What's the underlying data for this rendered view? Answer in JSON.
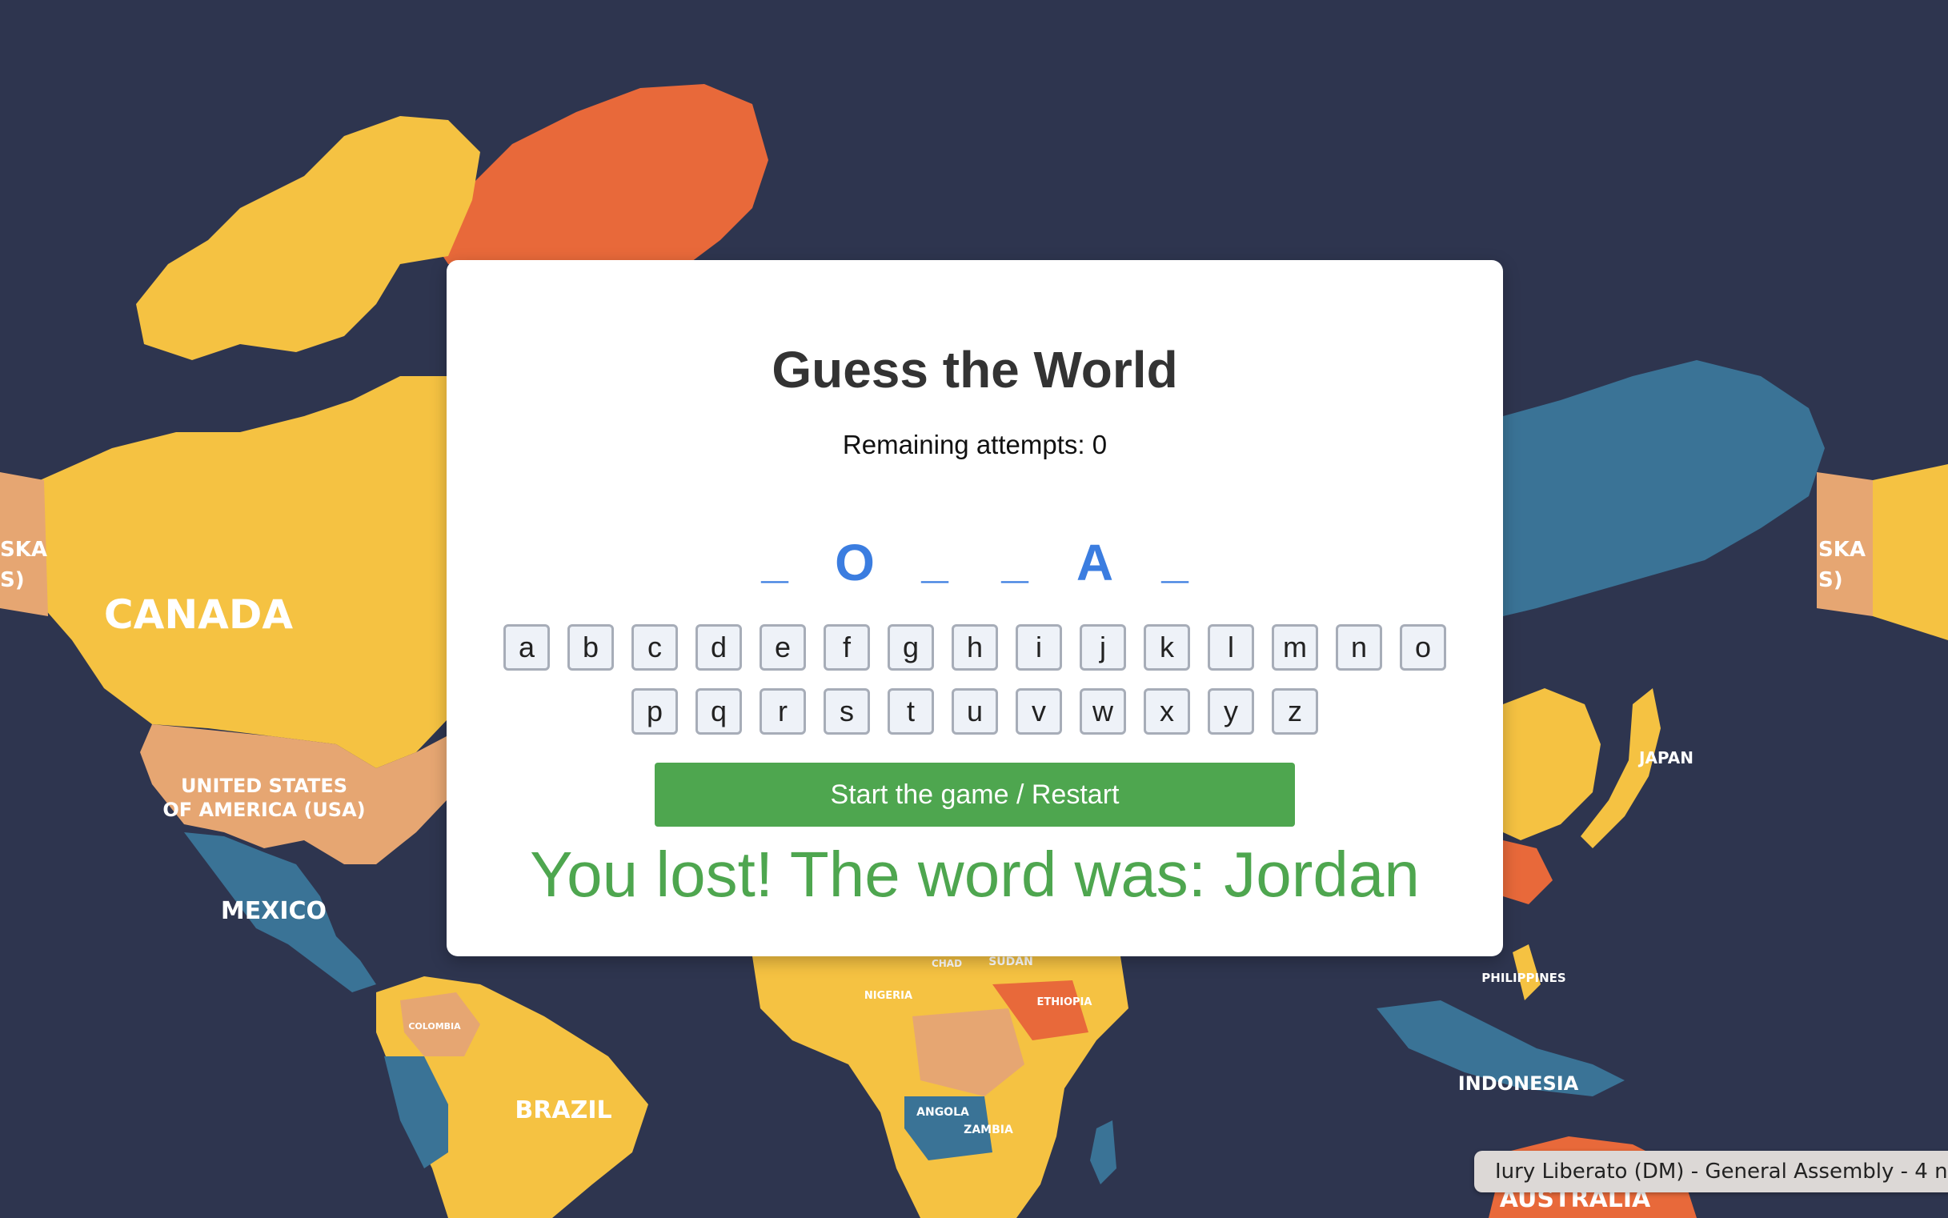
{
  "app": {
    "title": "Guess the World",
    "attempts_label": "Remaining attempts:",
    "attempts_value": "0"
  },
  "word": {
    "slots": [
      "_",
      "O",
      "_",
      "_",
      "A",
      "_"
    ]
  },
  "keyboard": {
    "row1": [
      "a",
      "b",
      "c",
      "d",
      "e",
      "f",
      "g",
      "h",
      "i",
      "j",
      "k",
      "l",
      "m",
      "n",
      "o"
    ],
    "row2": [
      "p",
      "q",
      "r",
      "s",
      "t",
      "u",
      "v",
      "w",
      "x",
      "y",
      "z"
    ]
  },
  "controls": {
    "start_label": "Start the game / Restart"
  },
  "result": {
    "message": "You lost! The word was: Jordan"
  },
  "map": {
    "labels": {
      "canada": "CANADA",
      "usa_line1": "UNITED STATES",
      "usa_line2": "OF AMERICA (USA)",
      "mexico": "MEXICO",
      "brazil": "BRAZIL",
      "japan": "JAPAN",
      "indonesia": "INDONESIA",
      "australia": "AUSTRALIA",
      "philippines": "PHILIPPINES",
      "angola": "ANGOLA",
      "zambia": "ZAMBIA",
      "nigeria": "NIGERIA",
      "ethiopia": "ETHIOPIA",
      "chad": "CHAD",
      "sudan": "SUDAN",
      "colombia": "COLOMBIA",
      "alaska_left": "SKA",
      "alaska_left2": "S)",
      "alaska_right": "SKA",
      "alaska_right2": "S)"
    }
  },
  "notification": {
    "text": "Iury Liberato (DM) - General Assembly - 4 n"
  },
  "colors": {
    "ocean": "#2e354f",
    "yellow": "#f5c242",
    "orange": "#e8693a",
    "tan": "#e6a672",
    "blue": "#3a7396",
    "accent_blue": "#3b7de0",
    "green": "#4ea64f"
  }
}
